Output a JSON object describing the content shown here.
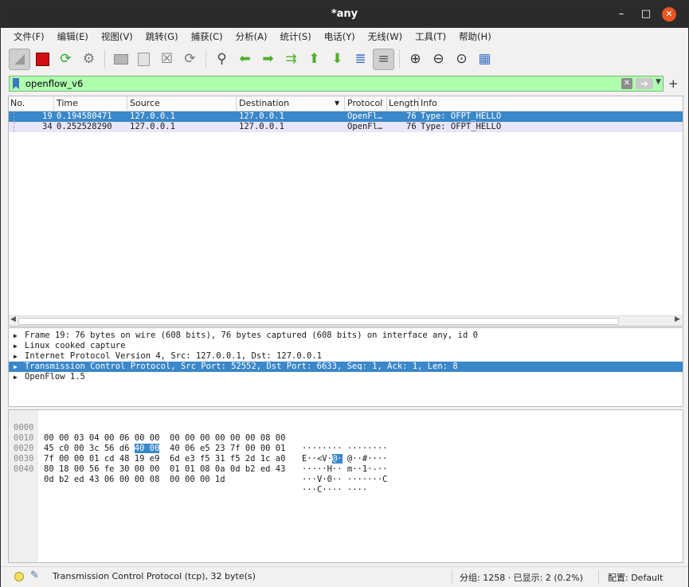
{
  "window": {
    "title": "*any"
  },
  "menu": [
    "文件(F)",
    "编辑(E)",
    "视图(V)",
    "跳转(G)",
    "捕获(C)",
    "分析(A)",
    "统计(S)",
    "电话(Y)",
    "无线(W)",
    "工具(T)",
    "帮助(H)"
  ],
  "toolbar": {
    "icons": [
      "shark-fin-icon",
      "stop-capture-icon",
      "restart-capture-icon",
      "capture-options-icon",
      "open-file-icon",
      "save-file-icon",
      "close-file-icon",
      "reload-file-icon",
      "find-packet-icon",
      "go-back-icon",
      "go-forward-icon",
      "go-to-packet-icon",
      "first-packet-icon",
      "last-packet-icon",
      "autoscroll-icon",
      "colorize-icon",
      "zoom-in-icon",
      "zoom-out-icon",
      "normal-size-icon",
      "resize-columns-icon"
    ]
  },
  "filter": {
    "value": "openflow_v6",
    "clear_icon": "clear-filter-icon",
    "apply_icon": "apply-filter-icon"
  },
  "packet_list": {
    "columns": [
      "No.",
      "Time",
      "Source",
      "Destination",
      "Protocol",
      "Length",
      "Info"
    ],
    "rows": [
      {
        "no": "19",
        "time": "0.194580471",
        "source": "127.0.0.1",
        "destination": "127.0.0.1",
        "protocol": "OpenFl…",
        "length": "76",
        "info": "Type: OFPT_HELLO"
      },
      {
        "no": "34",
        "time": "0.252528290",
        "source": "127.0.0.1",
        "destination": "127.0.0.1",
        "protocol": "OpenFl…",
        "length": "76",
        "info": "Type: OFPT_HELLO"
      }
    ]
  },
  "details": [
    "Frame 19: 76 bytes on wire (608 bits), 76 bytes captured (608 bits) on interface any, id 0",
    "Linux cooked capture",
    "Internet Protocol Version 4, Src: 127.0.0.1, Dst: 127.0.0.1",
    "Transmission Control Protocol, Src Port: 52552, Dst Port: 6633, Seq: 1, Ack: 1, Len: 8",
    "OpenFlow 1.5"
  ],
  "hex": [
    {
      "offset": "0000",
      "pre": "00 00 03 04 00 06 00 00  00 00 00 00 00 00 08 00",
      "hl": "",
      "post": "",
      "ascii_pre": "········ ········",
      "ascii_hl": "",
      "ascii_post": ""
    },
    {
      "offset": "0010",
      "pre": "45 c0 00 3c 56 d6 ",
      "hl": "40 00",
      "post": "  40 06 e5 23 7f 00 00 01",
      "ascii_pre": "E··<V·",
      "ascii_hl": "@·",
      "ascii_post": " @··#····"
    },
    {
      "offset": "0020",
      "pre": "7f 00 00 01 cd 48 19 e9  6d e3 f5 31 f5 2d 1c a0",
      "hl": "",
      "post": "",
      "ascii_pre": "·····H·· m··1·-··",
      "ascii_hl": "",
      "ascii_post": ""
    },
    {
      "offset": "0030",
      "pre": "80 18 00 56 fe 30 00 00  01 01 08 0a 0d b2 ed 43",
      "hl": "",
      "post": "",
      "ascii_pre": "···V·0·· ·······C",
      "ascii_hl": "",
      "ascii_post": ""
    },
    {
      "offset": "0040",
      "pre": "0d b2 ed 43 06 00 00 08  00 00 00 1d",
      "hl": "",
      "post": "",
      "ascii_pre": "···C···· ····",
      "ascii_hl": "",
      "ascii_post": ""
    }
  ],
  "status": {
    "text": "Transmission Control Protocol (tcp), 32 byte(s)",
    "packets": "分组: 1258 · 已显示: 2 (0.2%)",
    "profile": "配置: Default"
  }
}
